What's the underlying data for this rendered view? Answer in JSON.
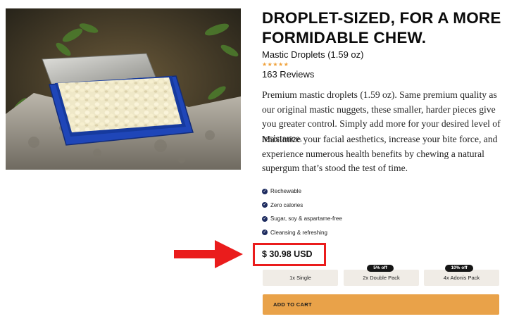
{
  "product": {
    "headline": "DROPLET-SIZED, FOR A MORE FORMIDABLE CHEW.",
    "name": "Mastic Droplets (1.59 oz)",
    "stars": "★★★★★",
    "reviews": "163 Reviews",
    "description": [
      "Premium mastic droplets (1.59 oz). Same premium quality as our original mastic nuggets, these smaller, harder pieces give you greater control. Simply add more for your desired level of resistance.",
      "Maximize your facial aesthetics, increase your bite force, and experience numerous health benefits by chewing a natural supergum that’s stood the test of time."
    ],
    "features": [
      "Rechewable",
      "Zero calories",
      "Sugar, soy & aspartame-free",
      "Cleansing & refreshing"
    ],
    "price": "$ 30.98 USD",
    "options": [
      {
        "label": "1x Single",
        "badge": ""
      },
      {
        "label": "2x Double Pack",
        "badge": "5% off"
      },
      {
        "label": "4x Adonis Pack",
        "badge": "10% off"
      }
    ],
    "cta": "ADD TO CART"
  },
  "icons": {
    "check": "check-circle-icon",
    "annotation_arrow": "right-arrow-icon"
  },
  "colors": {
    "cta": "#e9a249",
    "check_badge": "#1d2b5f",
    "highlight": "#ea1c1c",
    "stars": "#f0a23c",
    "option_bg": "#f0ece6",
    "tin": "#1f46b8"
  }
}
